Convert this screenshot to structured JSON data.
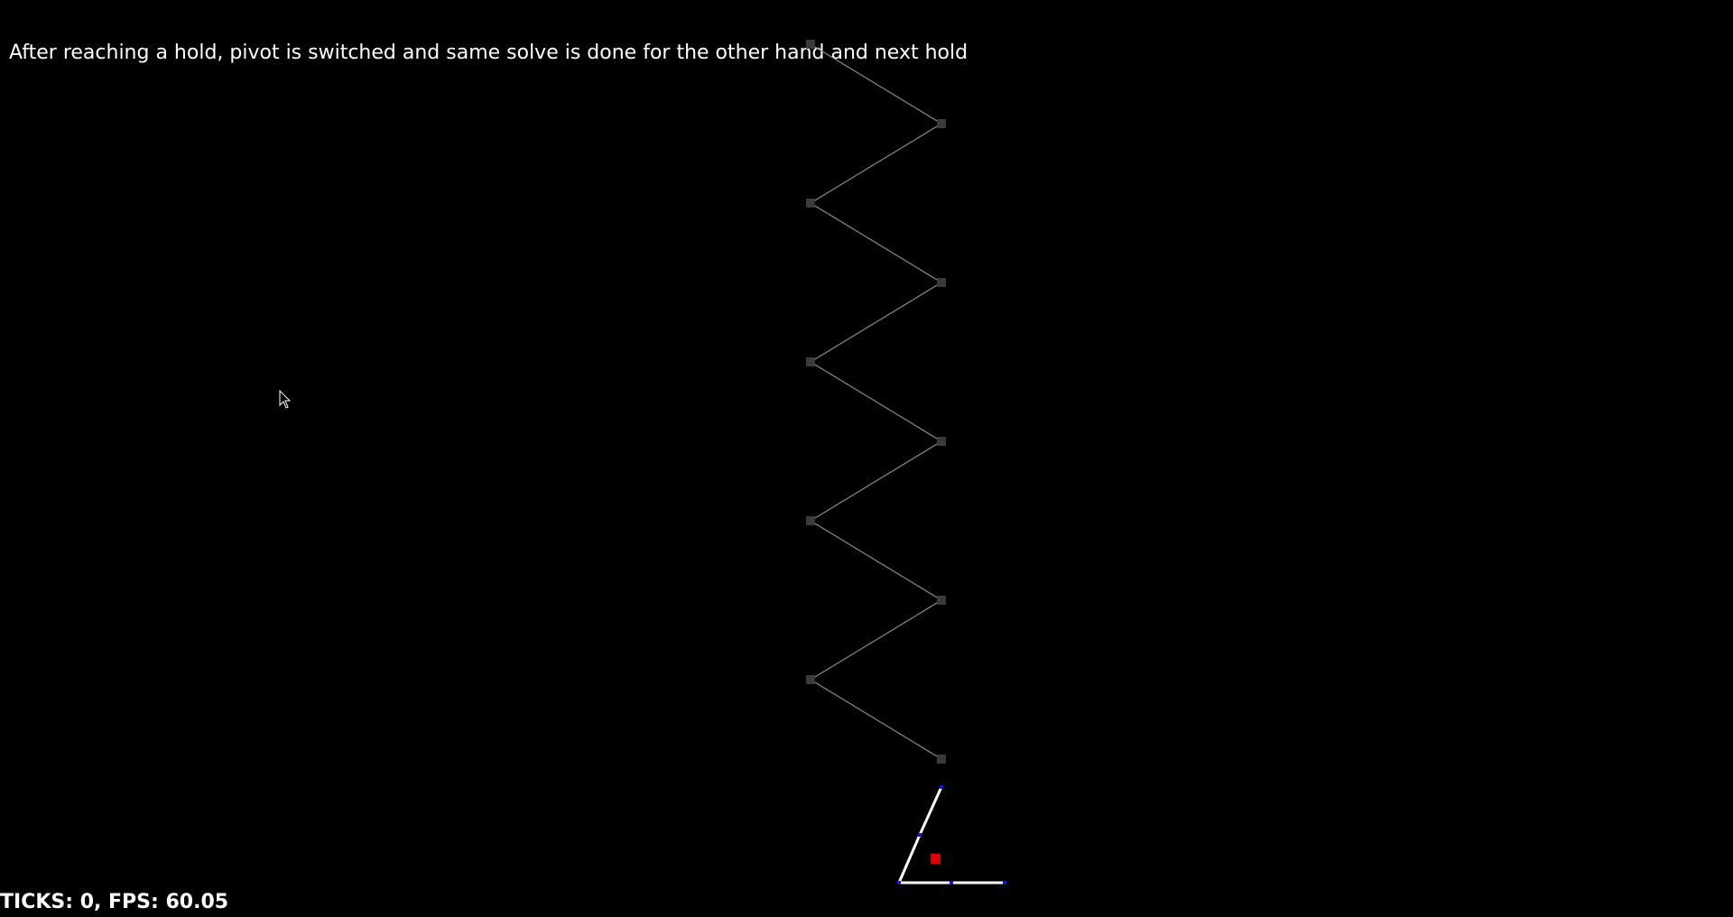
{
  "caption": "After reaching a hold, pivot is switched and same solve is done for the other hand and next hold",
  "stats": "TICKS: 0, FPS: 60.05",
  "colors": {
    "background": "#000000",
    "text": "#ffffff",
    "hold": "#3a3a3a",
    "route_line": "#8a8a8a",
    "limb": "#ffffff",
    "joint": "#1515d0",
    "target": "#e00000"
  },
  "icons": {
    "cursor": "mouse-pointer-icon"
  }
}
